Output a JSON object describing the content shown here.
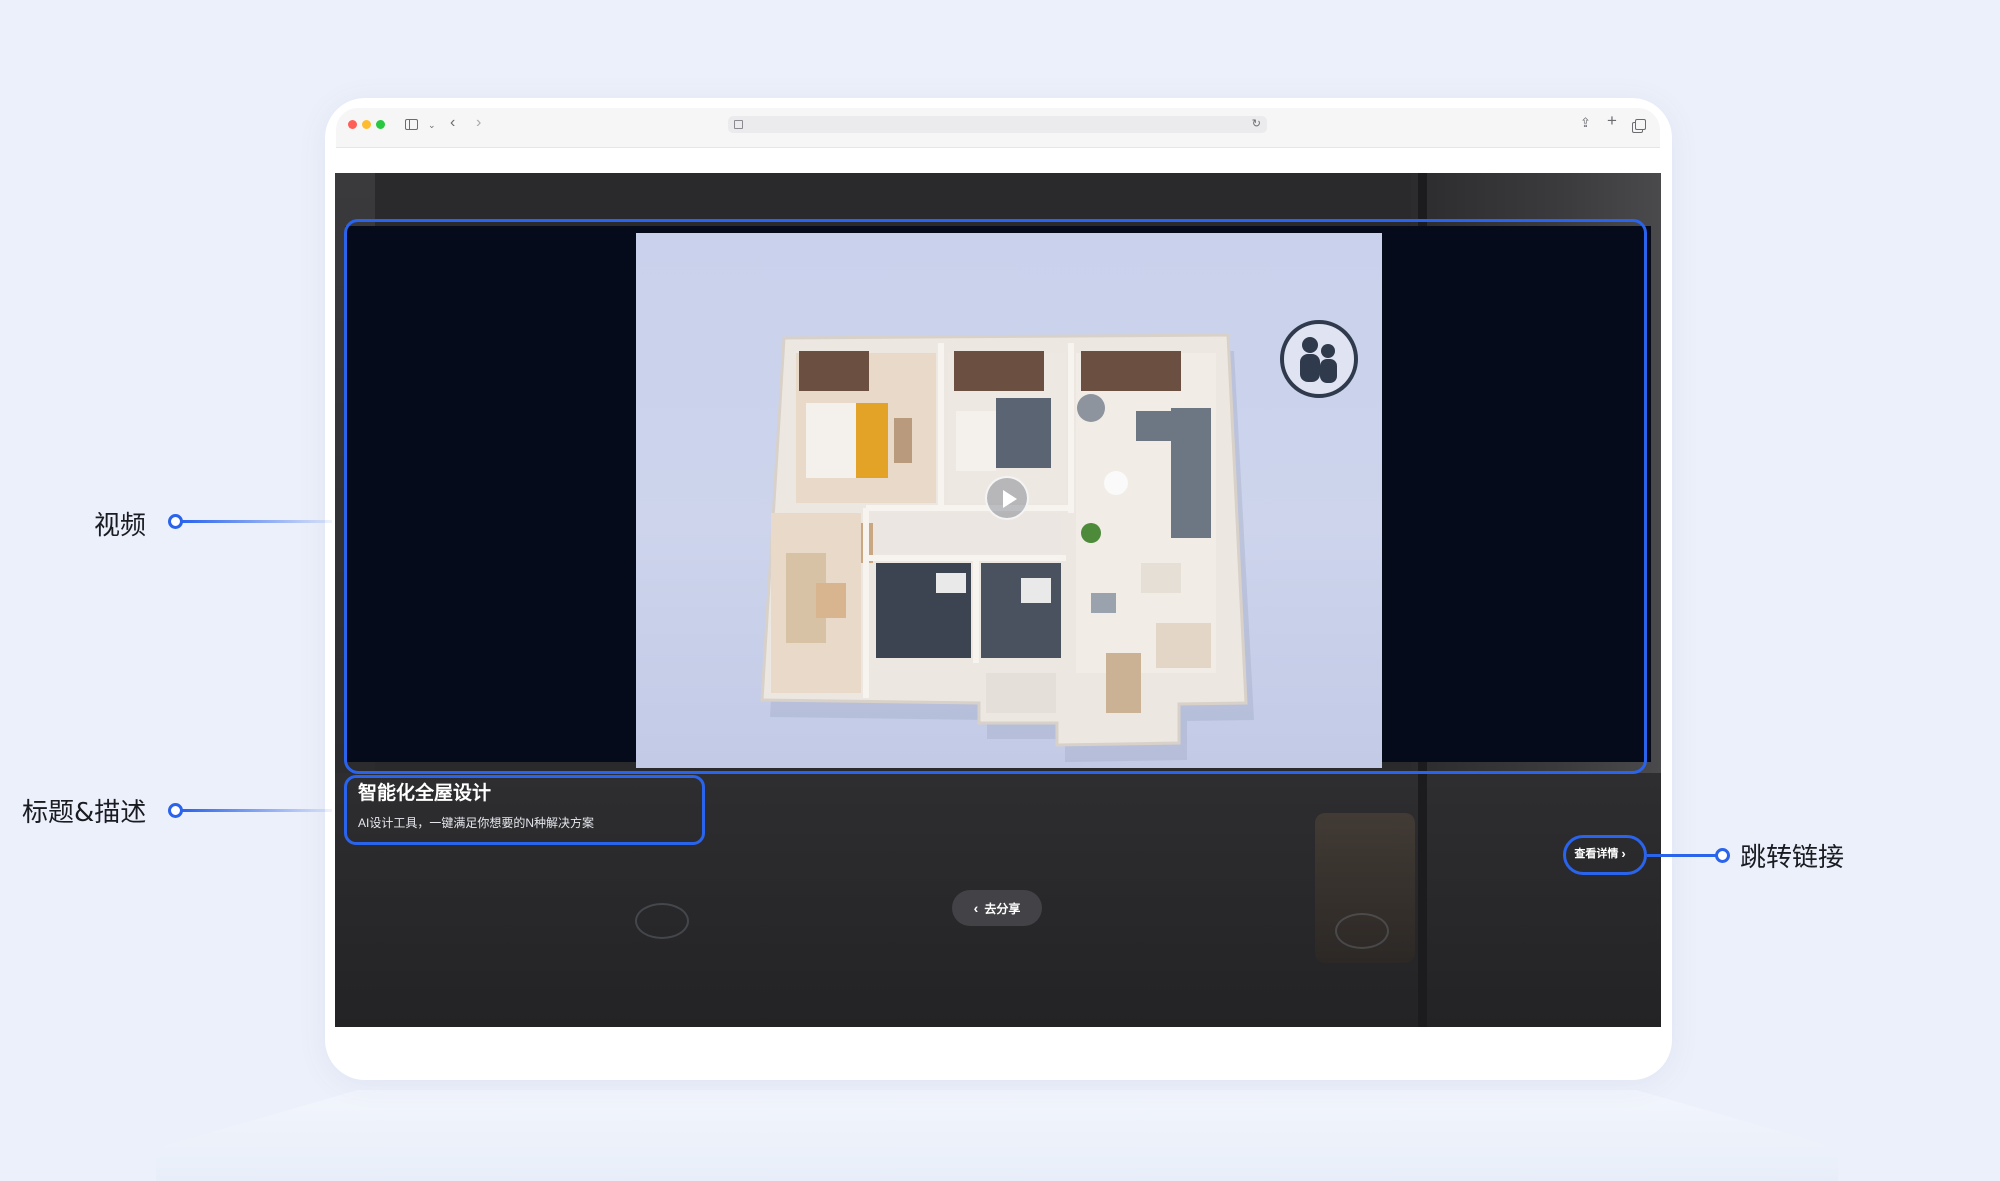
{
  "annotations": {
    "video": "视频",
    "title_desc": "标题&描述",
    "jump_link": "跳转链接"
  },
  "page": {
    "caption_title": "智能化全屋设计",
    "caption_desc": "AI设计工具，一键满足你想要的N种解决方案",
    "share_label": "去分享",
    "details_label": "查看详情"
  },
  "icons": {
    "share": "share-icon",
    "chevron": "chevron-right-icon",
    "play": "play-icon",
    "family": "family-icon"
  },
  "colors": {
    "accent": "#2a63ec",
    "background": "#ecf0fa",
    "video_bg": "#050b1b"
  }
}
